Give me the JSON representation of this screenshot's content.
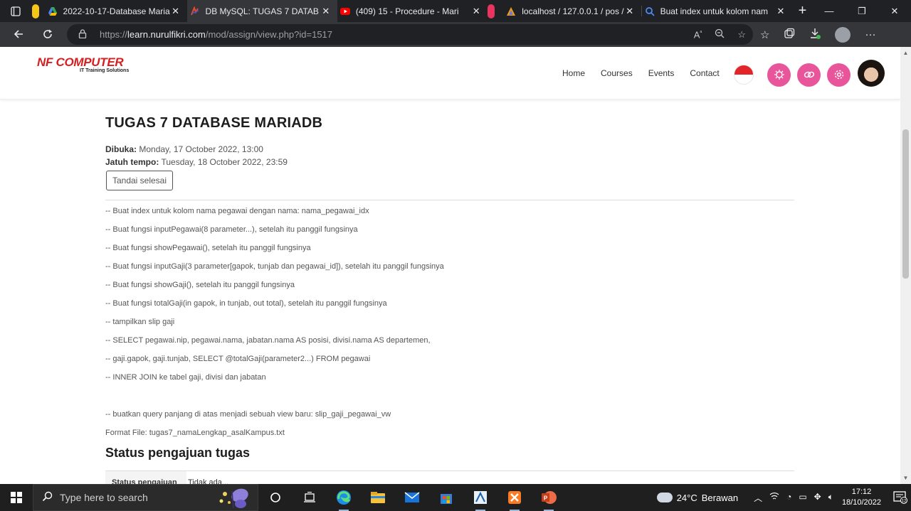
{
  "browser": {
    "tabs": [
      {
        "title": "2022-10-17-Database Maria",
        "icon": "google-drive-icon",
        "stripe": "#f5c518"
      },
      {
        "title": "DB MySQL: TUGAS 7 DATAB",
        "icon": "moodle-icon",
        "active": true
      },
      {
        "title": "(409) 15 - Procedure - Mari",
        "icon": "youtube-icon",
        "stripe": "#e8355f"
      },
      {
        "title": "localhost / 127.0.0.1 / pos /",
        "icon": "phpmyadmin-icon"
      },
      {
        "title": "Buat index untuk kolom nam",
        "icon": "search-icon"
      }
    ],
    "new_tab": "+",
    "url_prefix": "https://",
    "url_host": "learn.nurulfikri.com",
    "url_path": "/mod/assign/view.php?id=1517"
  },
  "site": {
    "brand": "NF COMPUTER",
    "tagline": "IT Training Solutions",
    "nav": [
      "Home",
      "Courses",
      "Events",
      "Contact"
    ],
    "flag_icon": "indonesia-flag-icon",
    "action_icons": [
      "gear-chat-icon",
      "link-icon",
      "settings-icon"
    ]
  },
  "assignment": {
    "title": "TUGAS 7 DATABASE MARIADB",
    "opened_label": "Dibuka:",
    "opened_value": "Monday, 17 October 2022, 13:00",
    "due_label": "Jatuh tempo:",
    "due_value": "Tuesday, 18 October 2022, 23:59",
    "done_button": "Tandai selesai",
    "instructions": [
      "-- Buat index untuk kolom nama pegawai dengan nama: nama_pegawai_idx",
      "-- Buat fungsi inputPegawai(8 parameter...), setelah itu panggil fungsinya",
      "-- Buat fungsi showPegawai(), setelah itu panggil fungsinya",
      "-- Buat fungsi inputGaji(3 parameter[gapok, tunjab dan pegawai_id]), setelah itu panggil fungsinya",
      "-- Buat fungsi showGaji(), setelah itu panggil fungsinya",
      "-- Buat fungsi totalGaji(in gapok, in tunjab, out total), setelah itu panggil fungsinya",
      "-- tampilkan slip gaji",
      "-- SELECT pegawai.nip, pegawai.nama, jabatan.nama AS posisi, divisi.nama AS departemen,",
      "-- gaji.gapok, gaji.tunjab, SELECT @totalGaji(parameter2...) FROM pegawai",
      "-- INNER JOIN ke tabel gaji, divisi dan jabatan",
      "-- buatkan query panjang di atas menjadi sebuah view baru: slip_gaji_pegawai_vw",
      "Format File: tugas7_namaLengkap_asalKampus.txt"
    ],
    "status_heading": "Status pengajuan tugas",
    "status_row_label": "Status pengajuan",
    "status_row_value": "Tidak ada..."
  },
  "taskbar": {
    "search_placeholder": "Type here to search",
    "weather_temp": "24°C",
    "weather_desc": "Berawan",
    "time": "17:12",
    "date": "18/10/2022",
    "notification_count": "12",
    "apps": [
      "task-view-icon",
      "timeline-icon",
      "edge-icon",
      "file-explorer-icon",
      "mail-icon",
      "store-icon",
      "snipping-icon",
      "xampp-icon",
      "powerpoint-icon"
    ]
  }
}
